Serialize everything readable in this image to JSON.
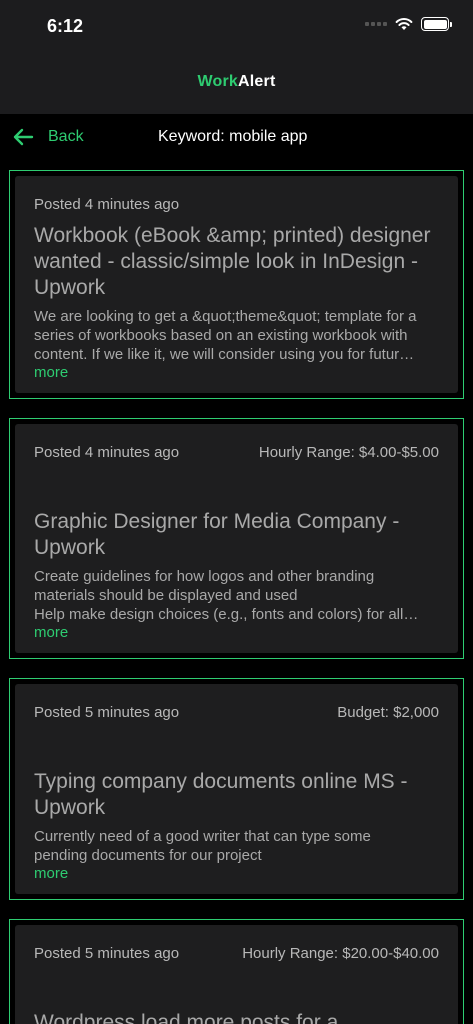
{
  "status": {
    "time": "6:12"
  },
  "header": {
    "title_accent": "Work",
    "title_rest": "Alert"
  },
  "nav": {
    "back_label": "Back",
    "keyword_label": "Keyword: mobile app"
  },
  "colors": {
    "accent": "#2ecc71",
    "card_bg": "#1e1e1f",
    "header_bg": "#1c1c1e"
  },
  "jobs": [
    {
      "posted": "Posted 4 minutes ago",
      "rate": "",
      "title": "Workbook (eBook &amp; printed) designer wanted - classic/simple look in InDesign - Upwork",
      "description_lines": [
        "We are looking to get a &quot;theme&quot; template for a",
        "series of workbooks based on an existing workbook with",
        "content. If we like it, we will consider using you for futur…"
      ],
      "more_label": "more"
    },
    {
      "posted": "Posted 4 minutes ago",
      "rate": "Hourly Range: $4.00-$5.00",
      "title": "Graphic Designer for Media Company - Upwork",
      "description_lines": [
        "Create guidelines for how logos and other branding",
        "materials should be displayed and used",
        "Help make design choices (e.g., fonts and colors) for all…"
      ],
      "more_label": "more"
    },
    {
      "posted": "Posted 5 minutes ago",
      "rate": "Budget: $2,000",
      "title": "Typing company documents online MS  - Upwork",
      "description_lines": [
        "Currently need of a good writer that can type some",
        "pending documents for our project"
      ],
      "more_label": "more"
    },
    {
      "posted": "Posted 5 minutes ago",
      "rate": "Hourly Range: $20.00-$40.00",
      "title": "Wordpress load more posts for a",
      "description_lines": [],
      "more_label": ""
    }
  ]
}
